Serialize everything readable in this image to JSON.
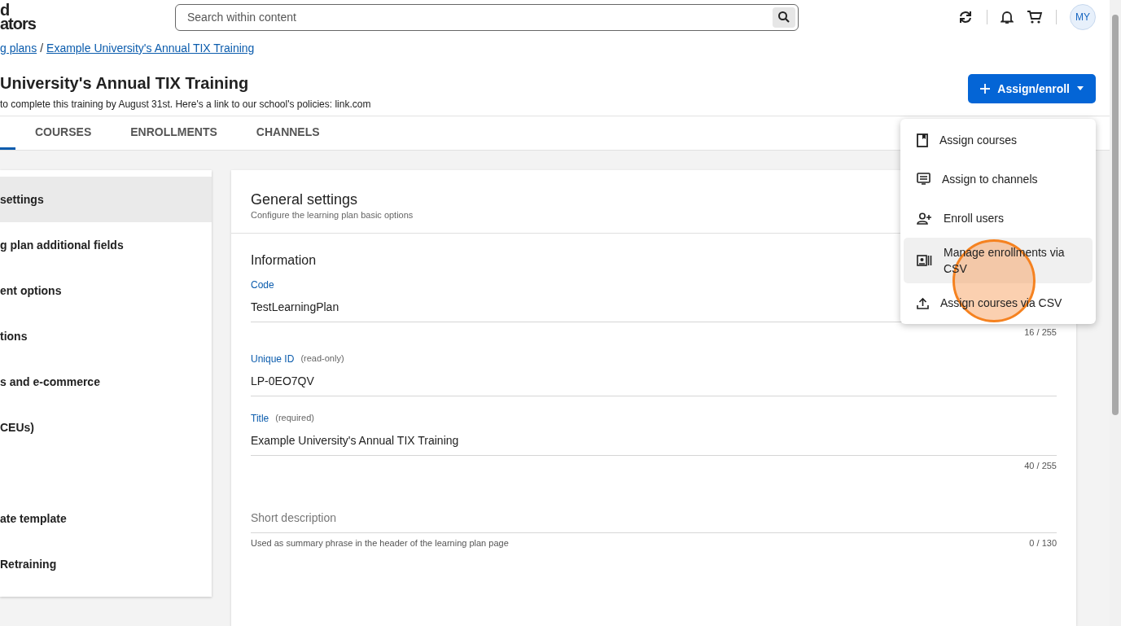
{
  "logo": {
    "lines": [
      "d",
      "ators"
    ]
  },
  "search": {
    "placeholder": "Search within content"
  },
  "user": {
    "initials": "MY"
  },
  "breadcrumb": [
    {
      "label": "g plans"
    },
    {
      "label": "Example University's Annual TIX Training"
    }
  ],
  "breadcrumb_separator": "/",
  "page": {
    "title": "University's Annual TIX Training",
    "description": "to complete this training by August 31st.  Here's a link to our school's policies: link.com"
  },
  "assign_button": {
    "label": "Assign/enroll",
    "expanded": true
  },
  "assign_menu": [
    {
      "kind": "book",
      "label": "Assign courses",
      "selected": false
    },
    {
      "kind": "channel",
      "label": "Assign to channels",
      "selected": false
    },
    {
      "kind": "user-add",
      "label": "Enroll users",
      "selected": false
    },
    {
      "kind": "csv",
      "label": "Manage enrollments via CSV",
      "selected": true
    },
    {
      "kind": "upload",
      "label": "Assign courses via CSV",
      "selected": false
    }
  ],
  "tabs": [
    {
      "selected": true
    },
    {
      "label": "COURSES",
      "selected": false
    },
    {
      "label": "ENROLLMENTS",
      "selected": false
    },
    {
      "label": "CHANNELS",
      "selected": false
    }
  ],
  "sidebar": {
    "items": [
      {
        "label": "settings",
        "selected": true
      },
      {
        "label": "g plan additional fields",
        "selected": false
      },
      {
        "label": "ent options",
        "selected": false
      },
      {
        "label": "tions",
        "selected": false
      },
      {
        "label": "s and e-commerce",
        "selected": false
      },
      {
        "label": "CEUs)",
        "selected": false
      },
      {
        "selected": false
      },
      {
        "label": "ate template",
        "selected": false
      },
      {
        "label": "Retraining",
        "selected": false
      }
    ]
  },
  "settings": {
    "title": "General settings",
    "subtitle": "Configure the learning plan basic options",
    "section": "Information",
    "fields": [
      {
        "label": "Code",
        "value": "TestLearningPlan",
        "counter": "16 / 255"
      },
      {
        "label": "Unique ID",
        "note": "(read-only)",
        "value": "LP-0EO7QV"
      },
      {
        "label": "Title",
        "note": "(required)",
        "value": "Example University's Annual TIX Training",
        "counter": "40 / 255"
      },
      {
        "placeholder": "Short description",
        "helper": "Used as summary phrase in the header of the learning plan page",
        "counter": "0 / 130"
      }
    ]
  },
  "click_indicator": true
}
